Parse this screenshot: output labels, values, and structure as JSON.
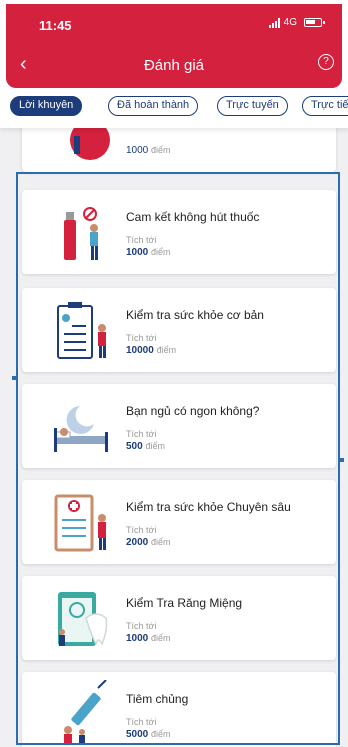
{
  "status": {
    "time": "11:45",
    "network": "4G"
  },
  "header": {
    "title": "Đánh giá",
    "back_icon": "‹",
    "help_icon": "?"
  },
  "tabs": [
    {
      "label": "Lời khuyên",
      "active": true
    },
    {
      "label": "Đã hoàn thành",
      "active": false
    },
    {
      "label": "Trực tuyến",
      "active": false
    },
    {
      "label": "Trực tiếp",
      "active": false
    }
  ],
  "points_label": "Tích tới",
  "points_unit": "điểm",
  "partial_card": {
    "points": "1000"
  },
  "cards": [
    {
      "name": "Cam kết không hút thuốc",
      "points": "1000"
    },
    {
      "name": "Kiểm tra sức khỏe cơ bản",
      "points": "10000"
    },
    {
      "name": "Bạn ngủ có ngon không?",
      "points": "500"
    },
    {
      "name": "Kiểm tra sức khỏe Chuyên sâu",
      "points": "2000"
    },
    {
      "name": "Kiểm Tra Răng Miệng",
      "points": "1000"
    },
    {
      "name": "Tiêm chủng",
      "points": "5000"
    }
  ],
  "colors": {
    "brand": "#d4213d",
    "accent": "#1c3c7b",
    "highlight": "#2b6cb0"
  }
}
